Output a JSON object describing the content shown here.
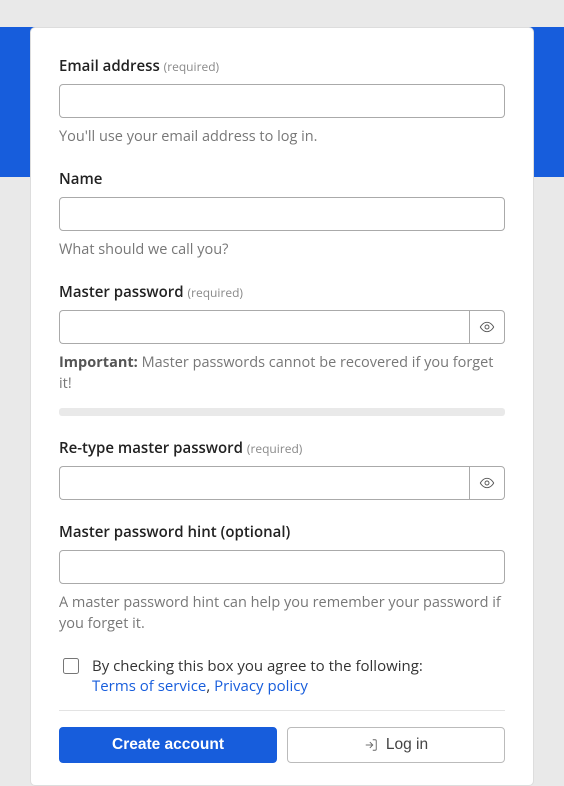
{
  "fields": {
    "email": {
      "label": "Email address",
      "required_text": "(required)",
      "help": "You'll use your email address to log in."
    },
    "name": {
      "label": "Name",
      "help": "What should we call you?"
    },
    "master_password": {
      "label": "Master password",
      "required_text": "(required)",
      "help_prefix": "Important:",
      "help": " Master passwords cannot be recovered if you forget it!"
    },
    "retype": {
      "label": "Re-type master password",
      "required_text": "(required)"
    },
    "hint": {
      "label": "Master password hint (optional)",
      "help": "A master password hint can help you remember your password if you forget it."
    }
  },
  "agree": {
    "text": "By checking this box you agree to the following:",
    "terms_label": "Terms of service",
    "separator": ", ",
    "privacy_label": "Privacy policy"
  },
  "buttons": {
    "create": "Create account",
    "login": "Log in"
  }
}
